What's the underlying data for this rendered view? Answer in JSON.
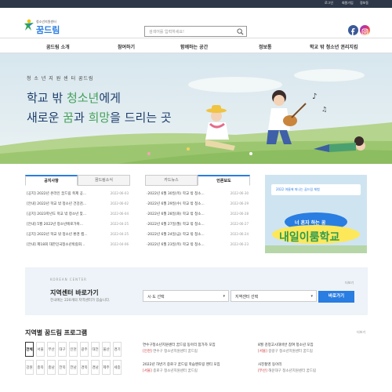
{
  "topbar": {
    "links": [
      "로그인",
      "회원가입",
      "정보동"
    ]
  },
  "header": {
    "logo_small": "청소년지원센터",
    "logo_big": "꿈드림",
    "search_placeholder": "검색어를 입력하세요!"
  },
  "nav": {
    "items": [
      "꿈드림 소개",
      "참여하기",
      "함께하는 공간",
      "정보통",
      "학교 밖 청소년 권리지킴"
    ]
  },
  "hero": {
    "subtitle": "청 소 년 지 원 센 터  꿈드림",
    "line1_a": "학교 밖 ",
    "line1_b": "청소년",
    "line1_c": "에게",
    "line2_a": "새로운 ",
    "line2_b": "꿈",
    "line2_c": "과 ",
    "line2_d": "희망",
    "line2_e": "을 드리는 곳"
  },
  "notice": {
    "tabs": [
      "공지사항",
      "꿈드림소식"
    ],
    "rows": [
      {
        "title": "[공지] 2022년 온라인 꿈드림 축제 공...",
        "date": "2022-06-03"
      },
      {
        "title": "[안내] 2022년 학교 밖 청소년 건강검...",
        "date": "2022-06-02"
      },
      {
        "title": "[공지] 2023학년도 학교 밖 청소년 맞...",
        "date": "2022-06-04"
      },
      {
        "title": "[안내] 5월 2022년 청소년에로가복...",
        "date": "2022-04-25"
      },
      {
        "title": "[공지] 2022년 학교 밖 청소년 환경 캠...",
        "date": "2022-04-25"
      },
      {
        "title": "[안내] 제18회 대한민국청소년박람회...",
        "date": "2022-04-06"
      }
    ]
  },
  "press": {
    "tabs": [
      "카드뉴스",
      "언론보도"
    ],
    "rows": [
      {
        "title": "·2022년 6월 30일(목) 학교 밖 청소...",
        "date": "2022-06-30"
      },
      {
        "title": "·2022년 6월 29일(수) 학교 밖 청소...",
        "date": "2022-06-29"
      },
      {
        "title": "·2022년 6월 28일(화) 학교 밖 청소...",
        "date": "2022-06-28"
      },
      {
        "title": "·2022년 6월 27일(월) 학교 밖 청소...",
        "date": "2022-06-27"
      },
      {
        "title": "·2022년 6월 24일(금) 학교 밖 청소...",
        "date": "2022-06-24"
      },
      {
        "title": "·2022년 6월 23일(목) 학교 밖 청소...",
        "date": "2022-06-23"
      }
    ]
  },
  "banner": {
    "top_text": "2022 여름에 떠나는 꿈드림 체험",
    "pill": "너 혼자 하는 꿈",
    "big": "내일이룸학교"
  },
  "center": {
    "eng": "KOREAN CENTER",
    "title": "지역센터 바로가기",
    "desc": "전국에는 220개의 지역센터가 있습니다.",
    "more": "더보기",
    "select1": "시·도 선택",
    "select2": "지역센터 선택",
    "button": "바로가기"
  },
  "programs": {
    "title": "지역별 꿈드림 프로그램",
    "more": "더보기",
    "regions_row1": [
      "전체",
      "서울",
      "부산",
      "대구",
      "인천",
      "광주",
      "대전",
      "울산",
      "경기"
    ],
    "regions_row2": [
      "강원",
      "충북",
      "충남",
      "전북",
      "전남",
      "경북",
      "경남",
      "제주",
      "세종"
    ],
    "items": [
      {
        "a": "연수구청소년지원센터 꿈드림 동아리 참가자 모집",
        "tag": "[인천]",
        "b": "연수구 청소년지원센터 꿈드림"
      },
      {
        "a": "8월 검정고시대비반 참여 청소년 모집",
        "tag": "[서울]",
        "b": "중랑구 청소년지원센터 꿈드림"
      },
      {
        "a": "2022년 하반기 중로구 꿈드림 학습멘토링 멘티 모집",
        "tag": "[서울]",
        "b": "종로구 청소년지원센터 꿈드림"
      },
      {
        "a": "사진촬영 동아리",
        "tag": "[부산]",
        "b": "해운대구 청소년지원센터 꿈드림"
      }
    ]
  }
}
